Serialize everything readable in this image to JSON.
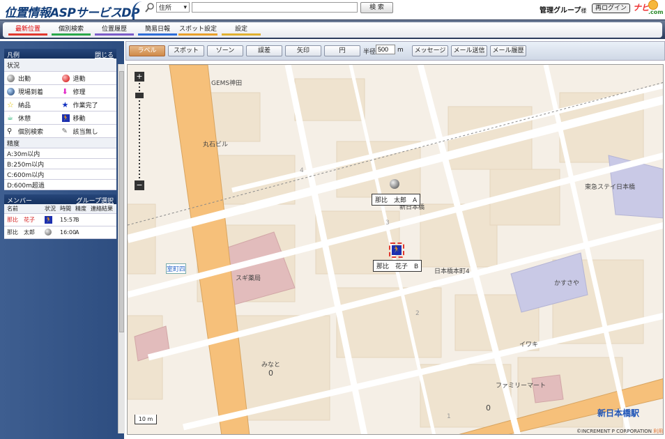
{
  "header": {
    "logo_text": "位置情報ASPサービスDP",
    "search_select": "住所",
    "search_value": "",
    "search_button": "検 索",
    "group_label": "管理グループ",
    "group_suffix": "様",
    "relogin_button": "再ログイン",
    "navi_brand": "ナビ",
    "navi_com": ".com"
  },
  "nav": {
    "tabs": [
      {
        "label": "最新位置",
        "color": "#e0382e"
      },
      {
        "label": "個別検索",
        "color": "#2aa84a"
      },
      {
        "label": "位置履歴",
        "color": "#7a5cc8"
      },
      {
        "label": "簡易日報",
        "color": "#2f6ed8"
      },
      {
        "label": "スポット設定",
        "color": "#e8a02a"
      },
      {
        "label": "設定",
        "color": "#e0b030"
      }
    ]
  },
  "toolbar": {
    "buttons": [
      "ラベル",
      "スポット",
      "ゾーン",
      "誤差",
      "矢印",
      "円"
    ],
    "radius_label": "半径",
    "radius_value": "500",
    "radius_unit": "m",
    "right_buttons": [
      "メッセージ",
      "メール送信",
      "メール履歴"
    ]
  },
  "legend": {
    "title": "凡例",
    "close_link": "閉じる",
    "status_header": "状況",
    "statuses": [
      [
        "出勤",
        "退勤"
      ],
      [
        "現場到着",
        "修理"
      ],
      [
        "納品",
        "作業完了"
      ],
      [
        "休憩",
        "移動"
      ],
      [
        "個別検索",
        "該当無し"
      ]
    ],
    "accuracy_header": "精度",
    "accuracy": [
      "A:30m以内",
      "B:250m以内",
      "C:600m以内",
      "D:600m超過"
    ]
  },
  "members": {
    "title": "メンバー",
    "group_link": "グループ選択",
    "columns": [
      "名前",
      "状況",
      "時間",
      "精度",
      "連絡結果"
    ],
    "rows": [
      {
        "name": "那比　花子",
        "time": "15:57",
        "accuracy": "B",
        "result": "",
        "name_color": "#d42020"
      },
      {
        "name": "那比　太郎",
        "time": "16:00",
        "accuracy": "A",
        "result": "",
        "name_color": "#111111"
      }
    ]
  },
  "map": {
    "labels": {
      "taro": "那比　太郎　A",
      "hanako": "那比　花子　B"
    },
    "places": {
      "gems": "GEMS神田",
      "maruishi": "丸石ビル",
      "tokyu": "東急ステイ日本橋",
      "shinnihonbashi": "新日本橋",
      "honcho": "日本橋本町4",
      "sugi": "スギ薬局",
      "kasusaya": "かすさや",
      "muromachi": "室町四",
      "iwaki": "イワキ",
      "minato": "みなと",
      "familymart": "ファミリーマート",
      "station": "新日本橋駅",
      "zero1": "0",
      "zero2": "0",
      "one": "1",
      "two": "2",
      "three": "3",
      "four": "4"
    },
    "scale": "10 m",
    "copyright": "©INCREMENT P CORPORATION",
    "terms": "利用規約"
  }
}
